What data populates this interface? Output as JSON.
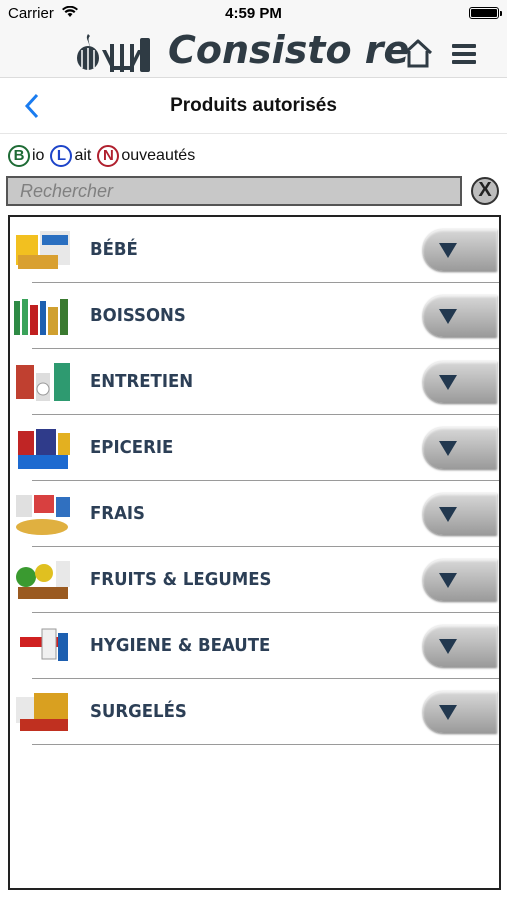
{
  "status_bar": {
    "carrier": "Carrier",
    "time": "4:59 PM"
  },
  "header": {
    "logo_text": "Consisto re",
    "icons": [
      "menorah-icon",
      "flame-icon",
      "home-icon",
      "hamburger-menu-icon"
    ],
    "brand_color": "#2f3b44"
  },
  "nav": {
    "title": "Produits autorisés",
    "back_icon": "chevron-left-icon",
    "accent_color": "#1a7cf0"
  },
  "legend": {
    "bio_letter": "B",
    "bio_text": "io",
    "lait_letter": "L",
    "lait_text": "ait",
    "nouveautes_letter": "N",
    "nouveautes_text": "ouveautés",
    "colors": {
      "bio": "#1e6b35",
      "lait": "#1d44c9",
      "nouveautes": "#b0202e"
    }
  },
  "search": {
    "placeholder": "Rechercher",
    "value": "",
    "clear_label": "X"
  },
  "categories": [
    {
      "label": "BÉBÉ",
      "thumb": "baby-products-image"
    },
    {
      "label": "BOISSONS",
      "thumb": "drinks-image"
    },
    {
      "label": "ENTRETIEN",
      "thumb": "cleaning-products-image"
    },
    {
      "label": "EPICERIE",
      "thumb": "grocery-image"
    },
    {
      "label": "FRAIS",
      "thumb": "fresh-products-image"
    },
    {
      "label": "FRUITS & LEGUMES",
      "thumb": "fruits-vegetables-image"
    },
    {
      "label": "HYGIENE & BEAUTE",
      "thumb": "hygiene-beauty-image"
    },
    {
      "label": "SURGELÉS",
      "thumb": "frozen-food-image"
    }
  ]
}
